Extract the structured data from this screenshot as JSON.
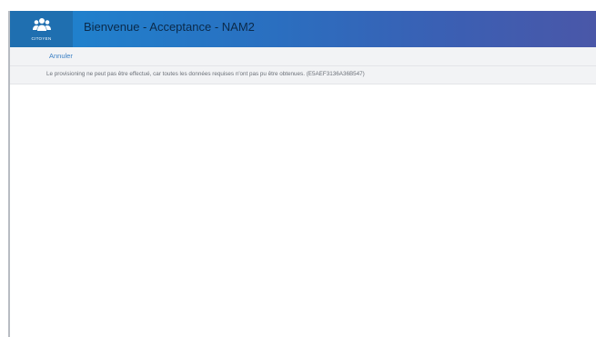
{
  "header": {
    "logo_label": "CITOYEN",
    "logo_icon": "users-group-icon",
    "title": "Bienvenue - Acceptance - NAM2"
  },
  "toolbar": {
    "cancel_label": "Annuler"
  },
  "message": {
    "text": "Le provisioning ne peut pas être effectué, car toutes les données requises n'ont pas pu être obtenues. (E5AEF3136A36B547)"
  },
  "colors": {
    "header_start": "#1d86d0",
    "header_end": "#4a57a8",
    "logo_box": "#1f6fb0",
    "link": "#3a7fc4",
    "bar_background": "#f2f3f5"
  }
}
